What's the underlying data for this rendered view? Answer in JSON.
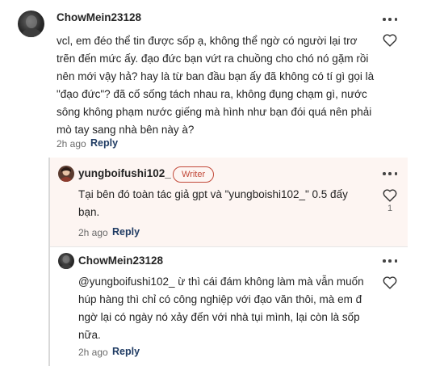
{
  "comments": [
    {
      "username": "ChowMein23128",
      "text": "vcl, em đéo thể tin được sốp ạ, không thể ngờ có người lại trơ\ntrẽn đến mức ấy. đạo đức bạn vứt ra chuồng cho chó nó gặm rồi\nnên mới vậy hả? hay là từ ban đầu bạn ấy đã không có tí gì gọi là\n\"đạo đức\"? đã cố sống tách nhau ra, không đụng chạm gì, nước\nsông không phạm nước giếng mà hình như bạn đói quá nên phải\nmò tay sang nhà bên này à?",
      "time": "2h ago",
      "reply_label": "Reply"
    },
    {
      "username": "yungboifushi102_",
      "badge": "Writer",
      "text": "Tại bên đó toàn tác giả gpt và \"yungboishi102_\" 0.5 đấy\nbạn.",
      "time": "2h ago",
      "reply_label": "Reply",
      "likes": "1"
    },
    {
      "username": "ChowMein23128",
      "text": "@yungboifushi102_ ừ thì cái đám không làm mà vẫn muốn\nhúp hàng thì chỉ có công nghiệp với đạo văn thôi, mà em đ\nngờ lại có ngày nó xảy đến với nhà tụi mình, lại còn là sốp\nnữa.",
      "time": "2h ago",
      "reply_label": "Reply"
    }
  ],
  "colors": {
    "reply_link": "#1f3b63",
    "writer_badge": "#c24a3a",
    "highlight_bg": "#fdf5f2"
  },
  "icons": [
    "more-options-icon",
    "heart-icon"
  ]
}
